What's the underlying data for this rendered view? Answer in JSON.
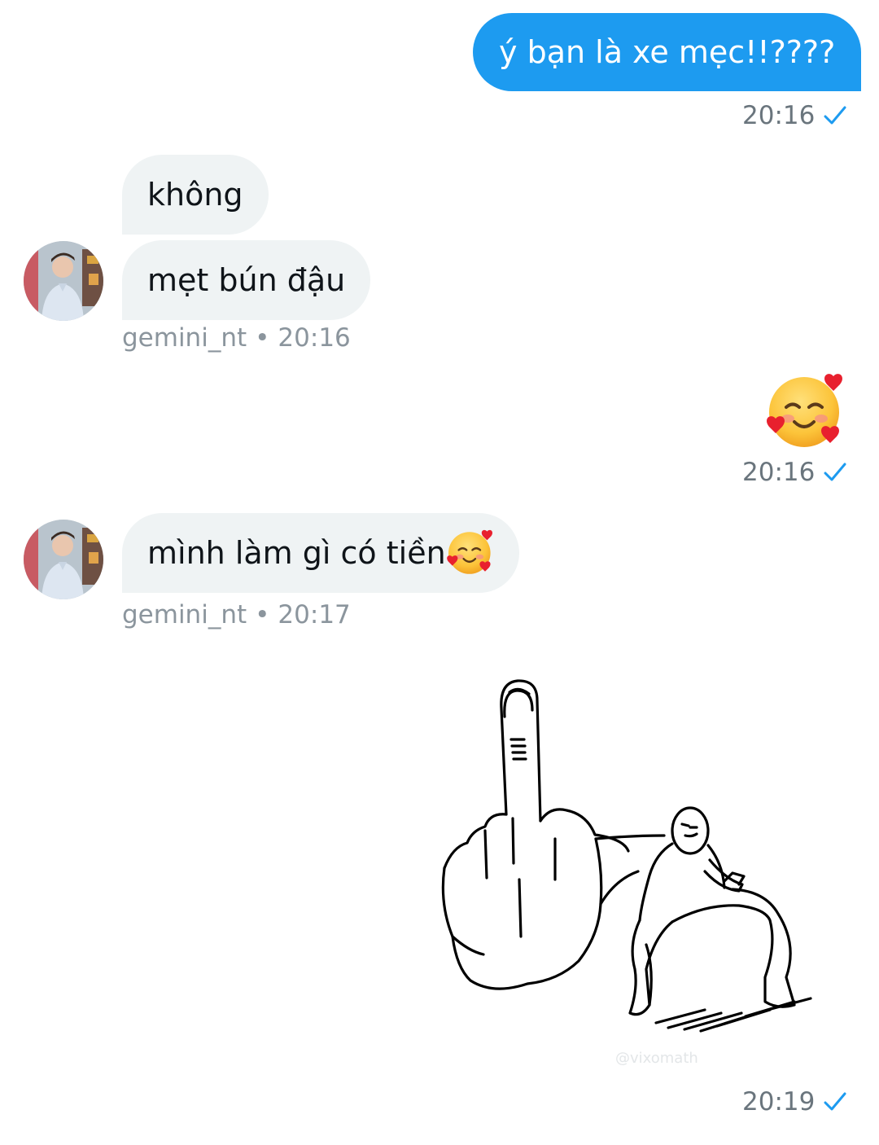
{
  "messages": {
    "m1": {
      "text": "ý bạn là xe mẹc!!????",
      "time": "20:16"
    },
    "m2": {
      "text": "không"
    },
    "m3": {
      "text": "mẹt bún đậu",
      "sender": "gemini_nt",
      "sep": "•",
      "time": "20:16"
    },
    "m4": {
      "emoji": "smiling-face-with-hearts",
      "time": "20:16"
    },
    "m5": {
      "text": "mình làm gì có tiền",
      "emoji": "smiling-face-with-hearts",
      "sender": "gemini_nt",
      "sep": "•",
      "time": "20:17"
    },
    "m6": {
      "sticker": "middle-finger-drawing",
      "watermark": "@vixomath",
      "time": "20:19"
    }
  },
  "colors": {
    "outgoing_bubble": "#1d9bf0",
    "incoming_bubble": "#eff3f4",
    "check": "#1d9bf0",
    "meta_text": "#8b959d"
  },
  "icons": {
    "read_receipt": "check-icon",
    "avatar": "user-avatar"
  }
}
